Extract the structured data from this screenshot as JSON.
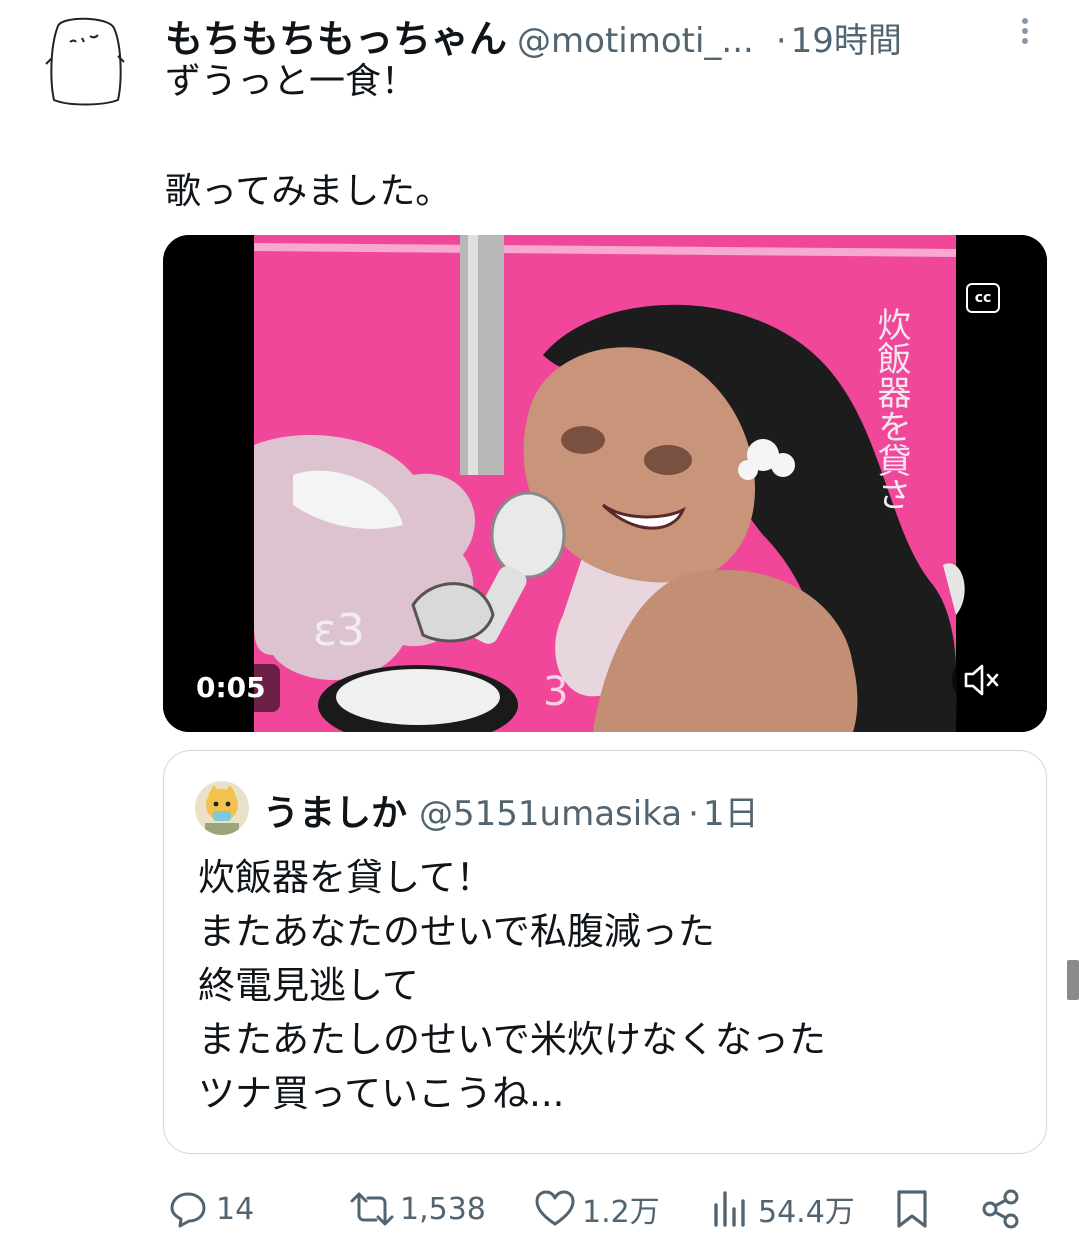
{
  "post": {
    "author_name": "もちもちもっちゃん",
    "author_handle": "@motimoti_...",
    "separator": "·",
    "time": "19時間",
    "text_lines": [
      "ずうっと一食！",
      "歌ってみました。"
    ]
  },
  "media": {
    "caption_button": "cc",
    "timestamp": "0:05",
    "overlay_text": "炊飯器を貸さ",
    "accent_color": "#f0479a"
  },
  "quote": {
    "author_name": "うましか",
    "author_handle": "@5151umasika",
    "separator": "·",
    "time": "1日",
    "text_lines": [
      "炊飯器を貸して！",
      "またあなたのせいで私腹減った",
      "終電見逃して",
      "またあたしのせいで米炊けなくなった",
      "ツナ買っていこうね..."
    ]
  },
  "actions": {
    "reply_count": "14",
    "retweet_count": "1,538",
    "like_count": "1.2万",
    "view_count": "54.4万"
  },
  "icons": [
    "more-icon",
    "cc-icon",
    "mute-icon",
    "reply-icon",
    "retweet-icon",
    "like-icon",
    "views-icon",
    "bookmark-icon",
    "share-icon"
  ]
}
